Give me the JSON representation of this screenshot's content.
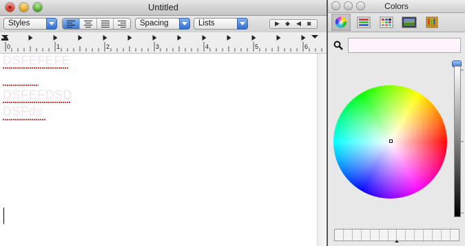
{
  "textedit": {
    "title": "Untitled",
    "toolbar": {
      "styles_label": "Styles",
      "spacing_label": "Spacing",
      "lists_label": "Lists",
      "alignment_options": [
        "align-left",
        "align-center",
        "justify",
        "align-right"
      ],
      "alignment_selected": "align-left"
    },
    "ruler": {
      "numbers": [
        "0",
        "1",
        "2",
        "3",
        "4",
        "5",
        "6"
      ]
    },
    "document": {
      "lines": [
        "DSFEFEFE",
        "...",
        "DSFEFDSD",
        "DSFds"
      ],
      "text_color": "#f3e3f1",
      "spellcheck_color": "#e23a3a"
    }
  },
  "colors_panel": {
    "title": "Colors",
    "modes": [
      "color-wheel",
      "color-sliders",
      "color-palettes",
      "image-palettes",
      "crayons"
    ],
    "selected_mode": "color-wheel",
    "search_placeholder": "",
    "search_field_color": "#fff4fd",
    "brightness": 1.0
  }
}
